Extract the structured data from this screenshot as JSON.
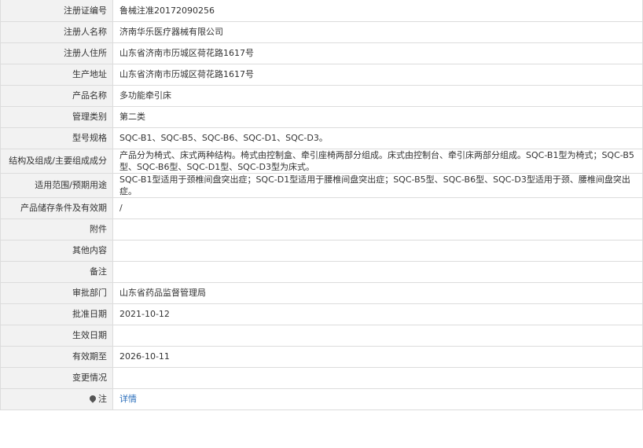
{
  "rows": [
    {
      "label": "注册证编号",
      "value": "鲁械注准20172090256"
    },
    {
      "label": "注册人名称",
      "value": "济南华乐医疗器械有限公司"
    },
    {
      "label": "注册人住所",
      "value": "山东省济南市历城区荷花路1617号"
    },
    {
      "label": "生产地址",
      "value": "山东省济南市历城区荷花路1617号"
    },
    {
      "label": "产品名称",
      "value": "多功能牵引床"
    },
    {
      "label": "管理类别",
      "value": "第二类"
    },
    {
      "label": "型号规格",
      "value": "SQC-B1、SQC-B5、SQC-B6、SQC-D1、SQC-D3。"
    },
    {
      "label": "结构及组成/主要组成成分",
      "value": "产品分为椅式、床式两种结构。椅式由控制盒、牵引座椅两部分组成。床式由控制台、牵引床两部分组成。SQC-B1型为椅式；SQC-B5型、SQC-B6型、SQC-D1型、SQC-D3型为床式。"
    },
    {
      "label": "适用范围/预期用途",
      "value": "SQC-B1型适用于颈椎间盘突出症；SQC-D1型适用于腰椎间盘突出症；SQC-B5型、SQC-B6型、SQC-D3型适用于颈、腰椎间盘突出症。"
    },
    {
      "label": "产品储存条件及有效期",
      "value": "/"
    },
    {
      "label": "附件",
      "value": ""
    },
    {
      "label": "其他内容",
      "value": ""
    },
    {
      "label": "备注",
      "value": ""
    },
    {
      "label": "审批部门",
      "value": "山东省药品监督管理局"
    },
    {
      "label": "批准日期",
      "value": "2021-10-12"
    },
    {
      "label": "生效日期",
      "value": ""
    },
    {
      "label": "有效期至",
      "value": "2026-10-11"
    },
    {
      "label": "变更情况",
      "value": ""
    },
    {
      "label": "注",
      "value": "详情",
      "icon": "map-pin-icon"
    }
  ]
}
